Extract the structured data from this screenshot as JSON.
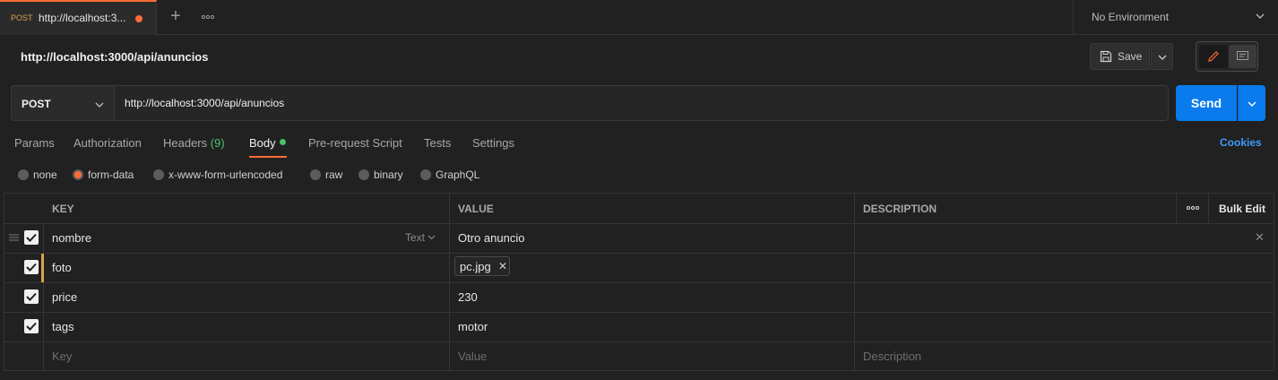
{
  "tab": {
    "method": "POST",
    "title": "http://localhost:3...",
    "new_tab_icon": "plus-icon",
    "more_icon": "more-horizontal-icon"
  },
  "environment": {
    "label": "No Environment"
  },
  "request": {
    "title": "http://localhost:3000/api/anuncios",
    "save_label": "Save",
    "method": "POST",
    "url": "http://localhost:3000/api/anuncios",
    "send_label": "Send"
  },
  "request_tabs": {
    "params": "Params",
    "authorization": "Authorization",
    "headers": "Headers",
    "headers_count": "(9)",
    "body": "Body",
    "pre_request": "Pre-request Script",
    "tests": "Tests",
    "settings": "Settings",
    "cookies": "Cookies"
  },
  "body_types": {
    "none": "none",
    "form_data": "form-data",
    "urlencoded": "x-www-form-urlencoded",
    "raw": "raw",
    "binary": "binary",
    "graphql": "GraphQL",
    "selected": "form-data"
  },
  "table": {
    "headers": {
      "key": "KEY",
      "value": "VALUE",
      "description": "DESCRIPTION",
      "bulk_edit": "Bulk Edit"
    },
    "rows": [
      {
        "key": "nombre",
        "type": "Text",
        "value": "Otro anuncio",
        "checked": true
      },
      {
        "key": "foto",
        "value": "pc.jpg",
        "checked": true
      },
      {
        "key": "price",
        "value": "230",
        "checked": true
      },
      {
        "key": "tags",
        "value": "motor",
        "checked": true
      }
    ],
    "placeholders": {
      "key": "Key",
      "value": "Value",
      "description": "Description"
    }
  },
  "colors": {
    "accent": "#ff6c37",
    "send": "#097bed",
    "success": "#4ec06b",
    "link": "#3f9bfa"
  }
}
